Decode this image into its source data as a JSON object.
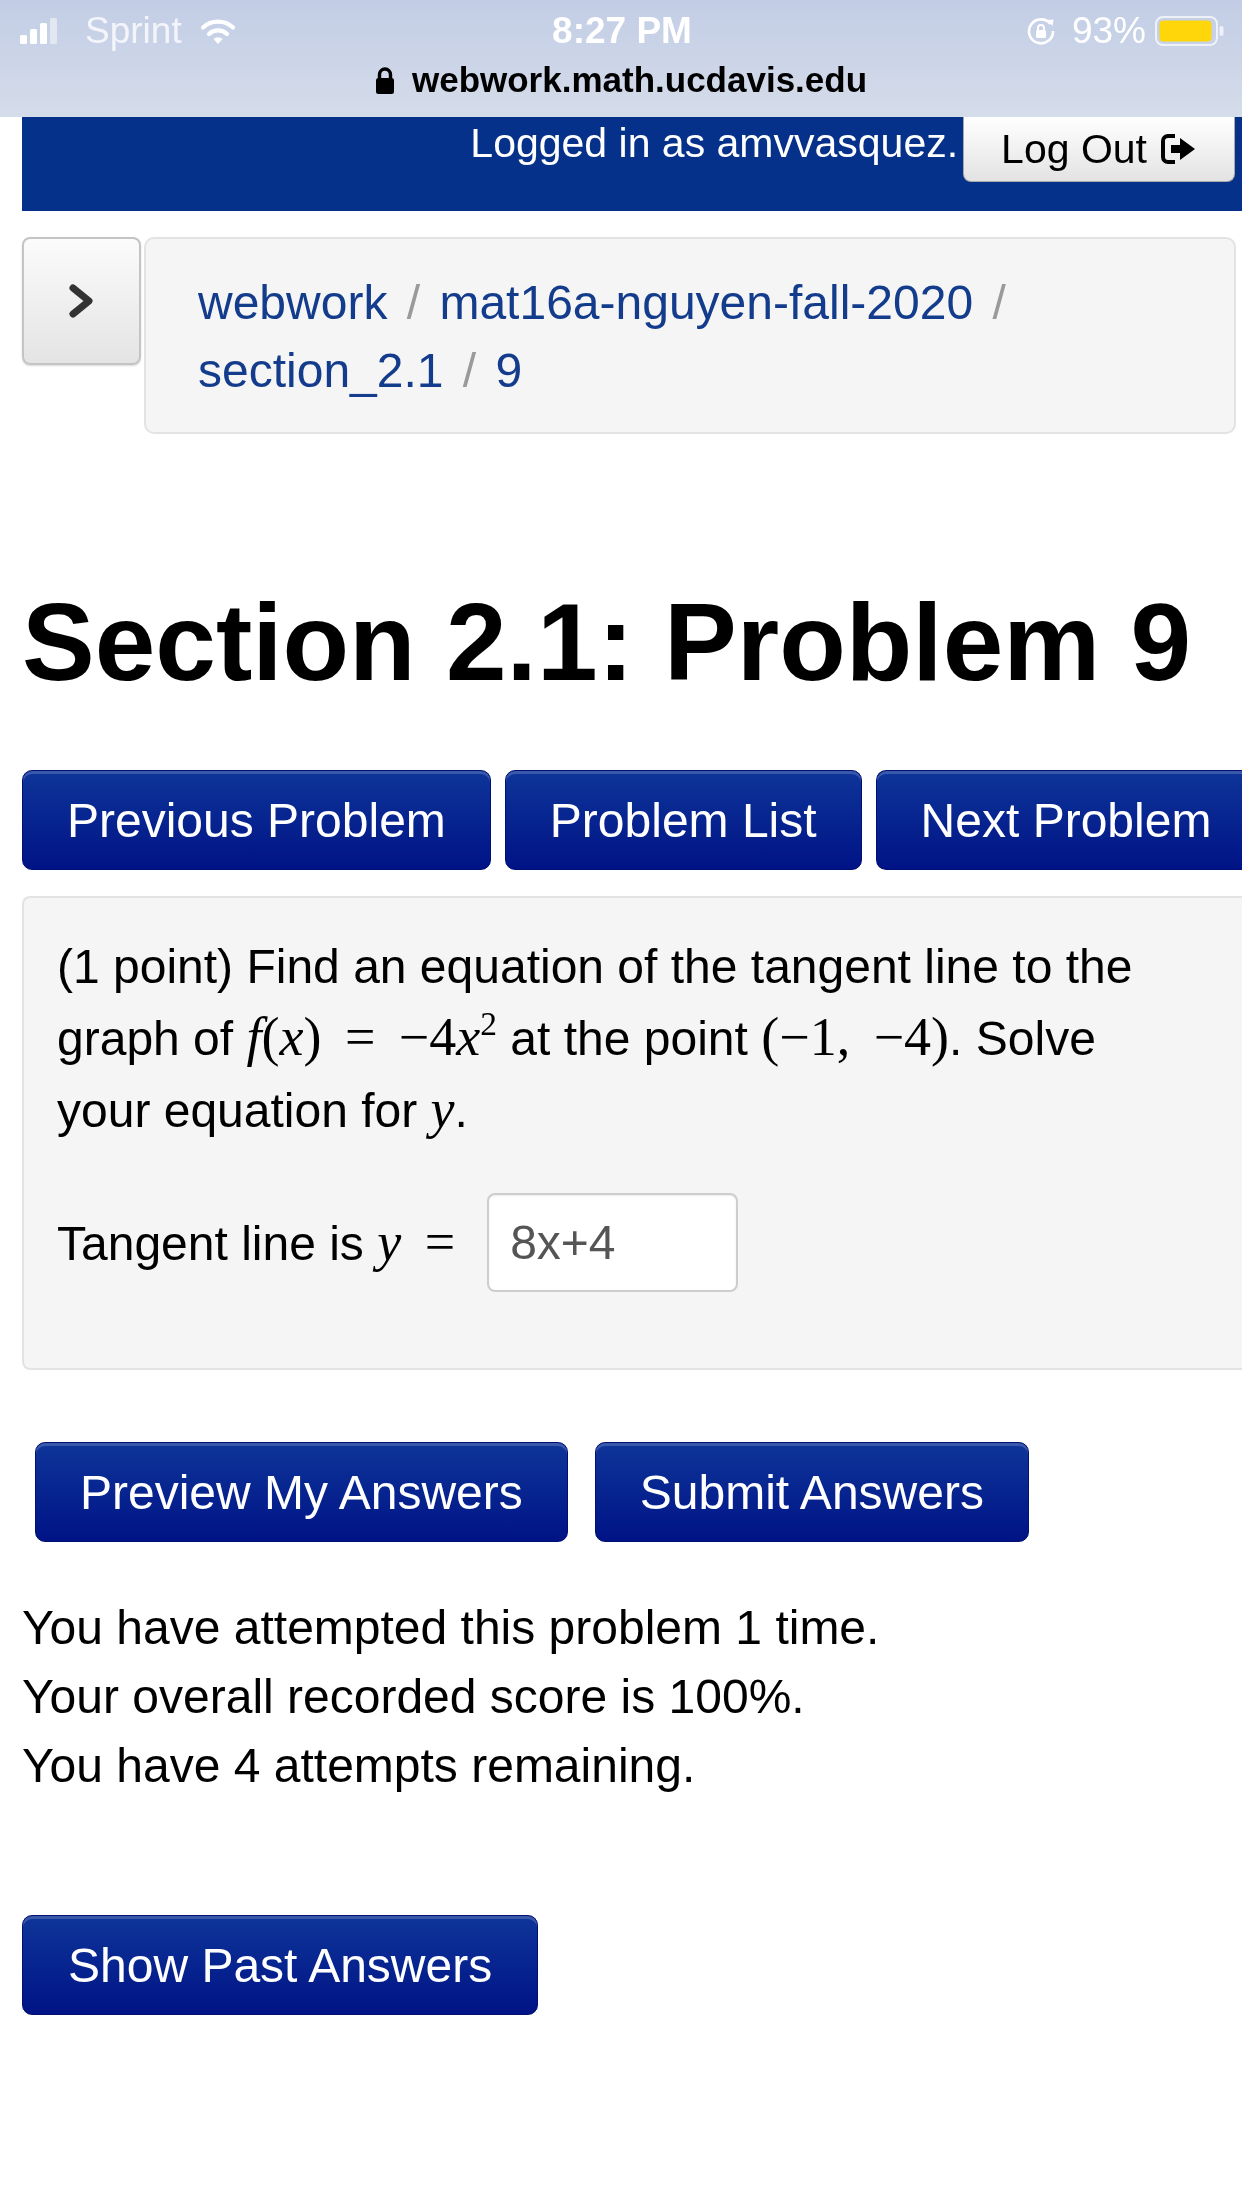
{
  "status_bar": {
    "carrier": "Sprint",
    "time": "8:27 PM",
    "battery": "93%"
  },
  "address_bar": {
    "url": "webwork.math.ucdavis.edu"
  },
  "header": {
    "login_text": "Logged in as amvvasquez.",
    "logout_button": "Log Out"
  },
  "breadcrumb": {
    "items": [
      {
        "label": "webwork",
        "separator": "/"
      },
      {
        "label": "mat16a-nguyen-fall-2020",
        "separator": "/"
      },
      {
        "label": "section_2.1",
        "separator": "/"
      },
      {
        "label": "9"
      }
    ]
  },
  "title": "Section 2.1: Problem 9",
  "nav_buttons": [
    "Previous Problem",
    "Problem List",
    "Next Problem"
  ],
  "problem": {
    "statement": [
      {
        "kind": "text",
        "text": "(1 point) Find an equation of the tangent line to the graph of "
      },
      {
        "kind": "math",
        "text": "*f*(*x*) = −4"
      },
      {
        "kind": "math",
        "text": "*x*$^{2}$"
      },
      {
        "kind": "text",
        "text": " at the point "
      },
      {
        "kind": "math",
        "text": "(−1, −4)"
      },
      {
        "kind": "text",
        "text": ". Solve your equation for "
      },
      {
        "kind": "math",
        "text": "*y*"
      },
      {
        "kind": "text",
        "text": "."
      }
    ],
    "answer": {
      "label": [
        {
          "kind": "text",
          "text": "Tangent line is "
        },
        {
          "kind": "math",
          "text": "*y* ="
        }
      ],
      "value": "8x+4"
    }
  },
  "answer_buttons": [
    "Preview My Answers",
    "Submit Answers"
  ],
  "status_lines": [
    "You have attempted this problem 1 time.",
    "Your overall recorded score is 100%.",
    "You have 4 attempts remaining."
  ],
  "past_answers_button": "Show Past Answers"
}
